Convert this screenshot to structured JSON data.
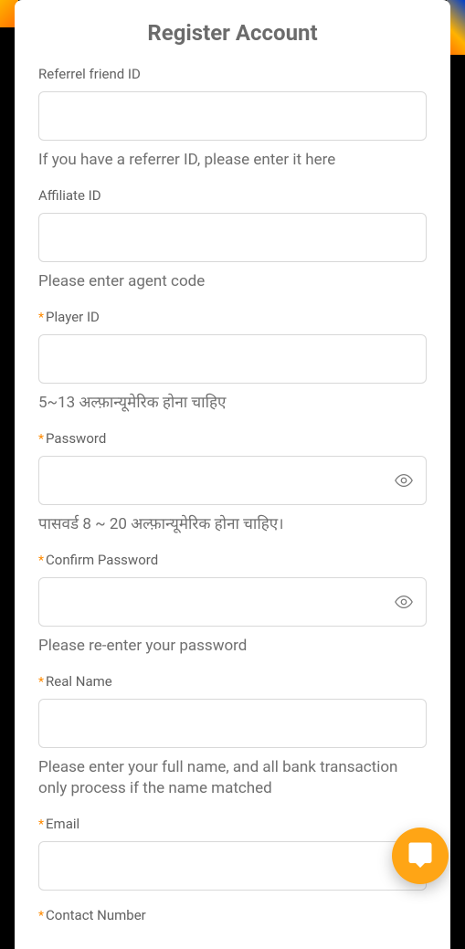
{
  "title": "Register Account",
  "fields": {
    "referrer": {
      "label": "Referrel friend ID",
      "hint": "If you have a referrer ID, please enter it here",
      "required": false
    },
    "affiliate": {
      "label": "Affiliate ID",
      "hint": "Please enter agent code",
      "required": false
    },
    "player": {
      "label": "Player ID",
      "hint": "5~13 अल्फ़ान्यूमेरिक होना चाहिए",
      "required": true
    },
    "password": {
      "label": "Password",
      "hint": "पासवर्ड 8 ~ 20 अल्फ़ान्यूमेरिक होना चाहिए।",
      "required": true
    },
    "confirm": {
      "label": "Confirm Password",
      "hint": "Please re-enter your password",
      "required": true
    },
    "realname": {
      "label": "Real Name",
      "hint": "Please enter your full name, and all bank transaction only process if the name matched",
      "required": true
    },
    "email": {
      "label": "Email",
      "required": true
    },
    "contact": {
      "label": "Contact Number",
      "required": true
    }
  },
  "required_mark": "*"
}
